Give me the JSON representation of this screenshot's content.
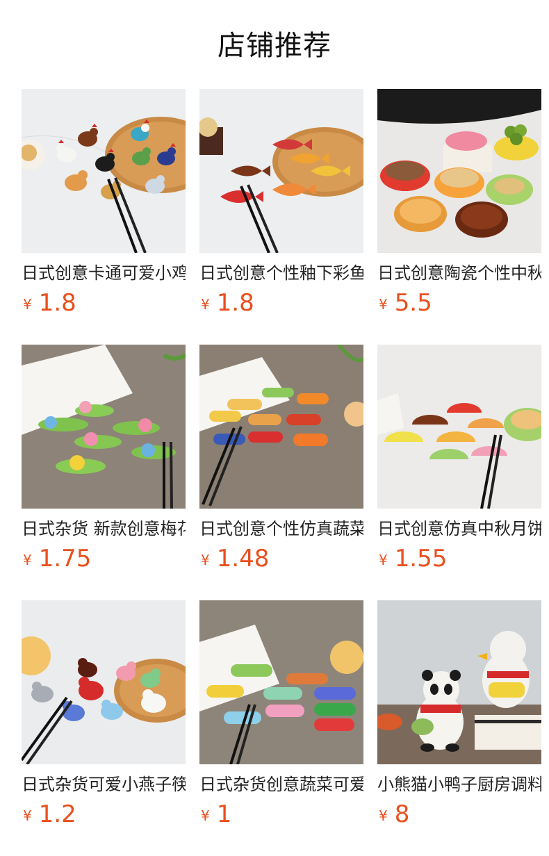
{
  "section": {
    "title": "店铺推荐"
  },
  "currency_symbol": "¥",
  "colors": {
    "price": "#e8501e",
    "title": "#111111",
    "text": "#222222"
  },
  "products": [
    {
      "name": "日式创意卡通可爱小鸡筷托",
      "price": "1.8",
      "image": "ceramic-chicken-chopstick-rests"
    },
    {
      "name": "日式创意个性釉下彩鱼筷托",
      "price": "1.8",
      "image": "ceramic-fish-chopstick-rests"
    },
    {
      "name": "日式创意陶瓷个性中秋月饼碟",
      "price": "5.5",
      "image": "mooncake-shaped-dishes"
    },
    {
      "name": "日式杂货 新款创意梅花筷托",
      "price": "1.75",
      "image": "plum-blossom-chopstick-rests"
    },
    {
      "name": "日式创意个性仿真蔬菜筷托",
      "price": "1.48",
      "image": "vegetable-chopstick-rests"
    },
    {
      "name": "日式创意仿真中秋月饼筷托",
      "price": "1.55",
      "image": "mooncake-chopstick-rests"
    },
    {
      "name": "日式杂货可爱小燕子筷托",
      "price": "1.2",
      "image": "swallow-bird-chopstick-rests"
    },
    {
      "name": "日式杂货创意蔬菜可爱筷托",
      "price": "1",
      "image": "pea-pod-chopstick-rests"
    },
    {
      "name": "小熊猫小鸭子厨房调料瓶",
      "price": "8",
      "image": "panda-duck-figurines"
    }
  ]
}
